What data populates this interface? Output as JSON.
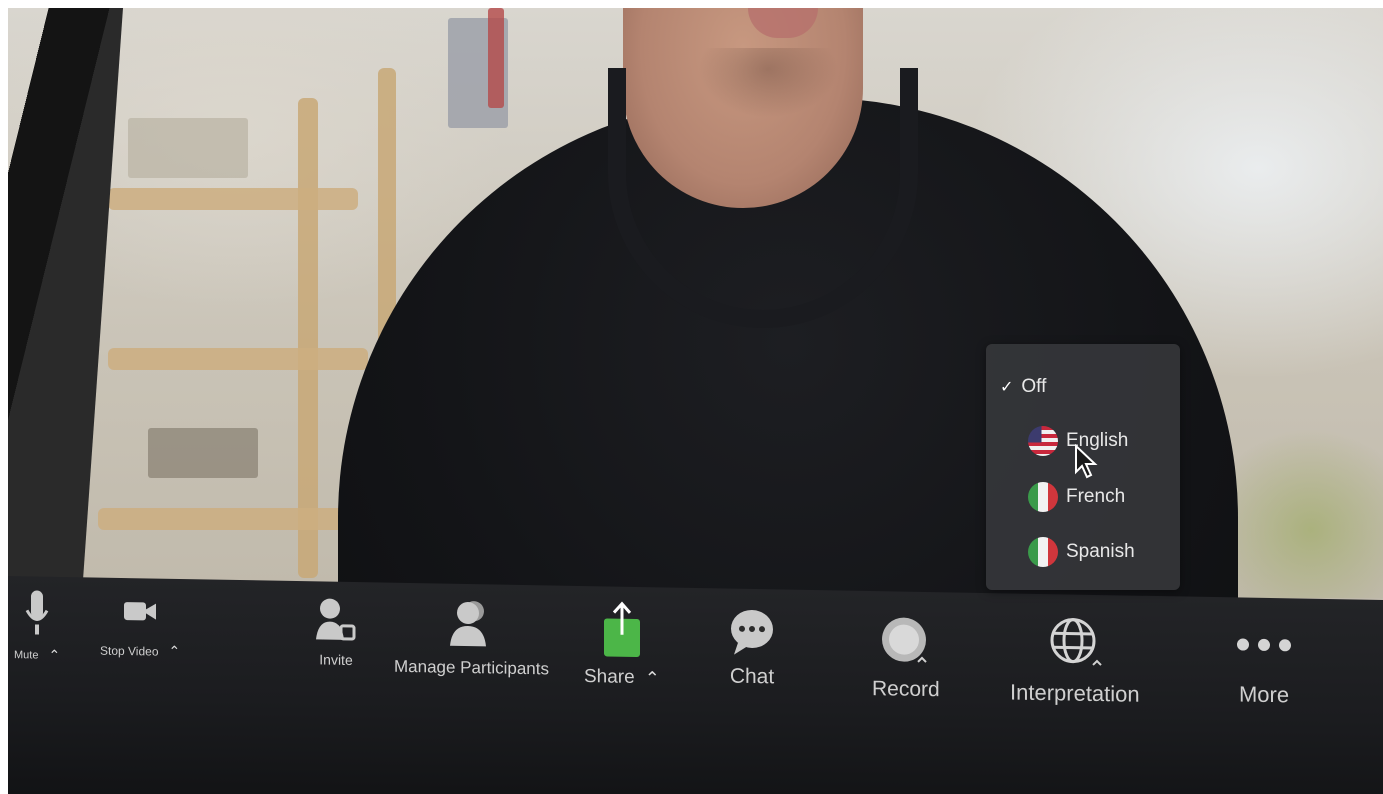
{
  "interpretation_menu": {
    "items": [
      {
        "label": "Off",
        "checked": true
      },
      {
        "label": "English",
        "flag": "us-flag-icon"
      },
      {
        "label": "French",
        "flag": "italy-flag-icon"
      },
      {
        "label": "Spanish",
        "flag": "italy-flag-icon"
      }
    ]
  },
  "toolbar": {
    "mute_label": "Mute",
    "stop_video_label": "Stop Video",
    "invite_label": "Invite",
    "manage_participants_label": "Manage Participants",
    "share_label": "Share",
    "chat_label": "Chat",
    "record_label": "Record",
    "interpretation_label": "Interpretation",
    "more_label": "More"
  },
  "colors": {
    "share_accent": "#4cb648",
    "toolbar_bg": "#1e1f22",
    "menu_bg": "#343538"
  }
}
